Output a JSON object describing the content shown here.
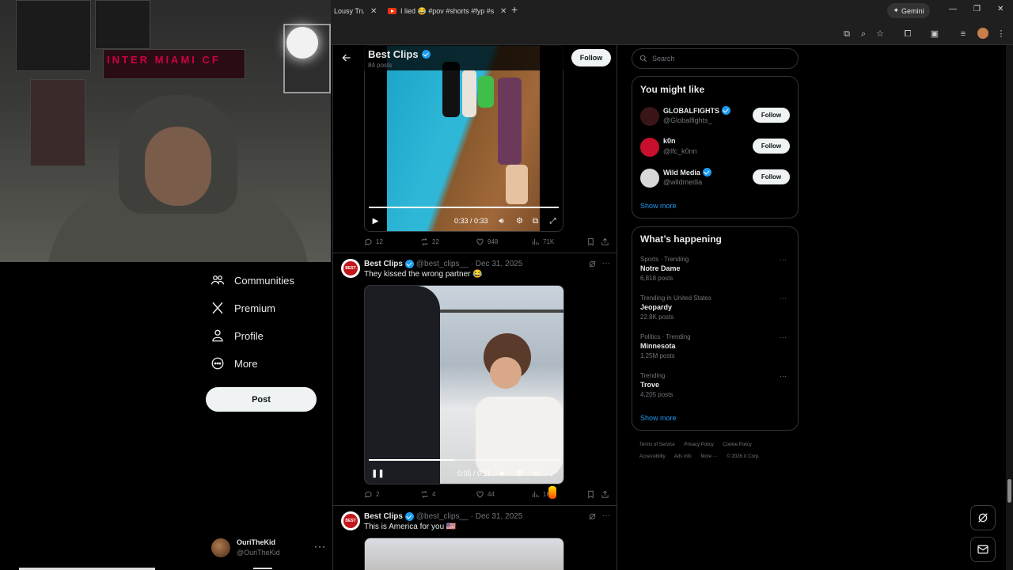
{
  "browser": {
    "tabs": [
      {
        "title": "Lousy Trut"
      },
      {
        "title": "I lied 😂 #pov #shorts #fyp #s"
      }
    ],
    "gemini_label": "Gemini"
  },
  "nav": {
    "items": [
      {
        "label": "Communities",
        "icon": "communities-icon"
      },
      {
        "label": "Premium",
        "icon": "x-logo-icon"
      },
      {
        "label": "Profile",
        "icon": "profile-icon"
      },
      {
        "label": "More",
        "icon": "more-circle-icon"
      }
    ],
    "post_button": "Post",
    "account": {
      "name": "OuriTheKid",
      "handle": "@OuriTheKid"
    }
  },
  "profile_header": {
    "title": "Best Clips",
    "subtitle": "84 posts",
    "follow_label": "Follow"
  },
  "tweets": [
    {
      "video": {
        "time": "0:33 / 0:33",
        "state": "ended",
        "progress": 1.0
      },
      "stats": {
        "replies": "12",
        "reposts": "22",
        "likes": "948",
        "views": "71K"
      }
    },
    {
      "author": "Best Clips",
      "handle": "@best_clips__",
      "date": "· Dec 31, 2025",
      "text": "They kissed the wrong partner 😂",
      "avatar_text": "BEST",
      "video": {
        "time": "0:05 / 0:11",
        "state": "playing",
        "progress": 0.45
      },
      "stats": {
        "replies": "2",
        "reposts": "4",
        "likes": "44",
        "views": "1K"
      }
    },
    {
      "author": "Best Clips",
      "handle": "@best_clips__",
      "date": "· Dec 31, 2025",
      "text": "This is America for you 🇺🇸",
      "avatar_text": "BEST"
    }
  ],
  "sidebar": {
    "search_placeholder": "Search",
    "you_might_like": {
      "title": "You might like",
      "accounts": [
        {
          "name": "GLOBALFIGHTS",
          "handle": "@Globalfights_",
          "verified": true,
          "avatar_color": "#3a1518"
        },
        {
          "name": "k0n",
          "handle": "@lfc_k0nn",
          "verified": false,
          "avatar_color": "#c8102e"
        },
        {
          "name": "Wild Media",
          "handle": "@wildmedia",
          "verified": true,
          "avatar_color": "#d8d8d8"
        }
      ],
      "follow_label": "Follow",
      "show_more": "Show more"
    },
    "whats_happening": {
      "title": "What’s happening",
      "trends": [
        {
          "context": "Sports · Trending",
          "title": "Notre Dame",
          "count": "6,818 posts"
        },
        {
          "context": "Trending in United States",
          "title": "Jeopardy",
          "count": "22.8K posts"
        },
        {
          "context": "Politics · Trending",
          "title": "Minnesota",
          "count": "1.25M posts"
        },
        {
          "context": "Trending",
          "title": "Trove",
          "count": "4,205 posts"
        }
      ],
      "show_more": "Show more"
    },
    "footer": {
      "links": [
        "Terms of Service",
        "Privacy Policy",
        "Cookie Policy",
        "Accessibility",
        "Ads info",
        "More ···"
      ],
      "copyright": "© 2026 X Corp."
    }
  },
  "webcam": {
    "banner_text": "INTER MIAMI CF"
  },
  "colors": {
    "accent": "#1d9bf0",
    "background": "#000000",
    "border": "#2f3336",
    "muted": "#71767b"
  }
}
